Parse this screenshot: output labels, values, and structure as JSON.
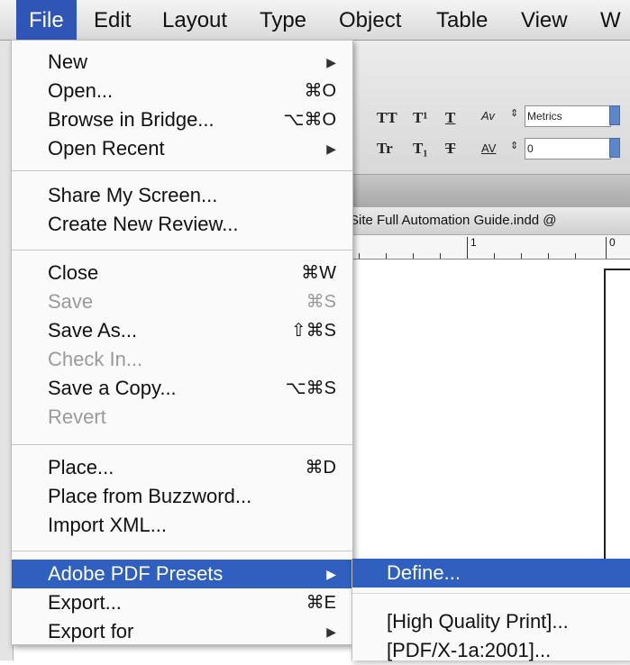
{
  "menubar": {
    "items": [
      {
        "label": "File"
      },
      {
        "label": "Edit"
      },
      {
        "label": "Layout"
      },
      {
        "label": "Type"
      },
      {
        "label": "Object"
      },
      {
        "label": "Table"
      },
      {
        "label": "View"
      },
      {
        "label": "W"
      }
    ],
    "active_color": "#2f56b7"
  },
  "toolbar": {
    "all_caps": "TT",
    "superscript": "T¹",
    "underline": "T",
    "small_caps": "Tr",
    "subscript": "T₁",
    "strikethrough": "T",
    "kerning_icon": "Av",
    "tracking_icon": "AV",
    "kerning_value": "Metrics",
    "tracking_value": "0"
  },
  "document": {
    "title": "Site Full Automation Guide.indd @",
    "ruler_numbers": [
      "1",
      "0"
    ]
  },
  "file_menu": {
    "sections": [
      [
        {
          "label": "New",
          "shortcut": "",
          "submenu": true,
          "enabled": true
        },
        {
          "label": "Open...",
          "shortcut": "⌘O",
          "submenu": false,
          "enabled": true
        },
        {
          "label": "Browse in Bridge...",
          "shortcut": "⌥⌘O",
          "submenu": false,
          "enabled": true
        },
        {
          "label": "Open Recent",
          "shortcut": "",
          "submenu": true,
          "enabled": true
        }
      ],
      [
        {
          "label": "Share My Screen...",
          "shortcut": "",
          "submenu": false,
          "enabled": true
        },
        {
          "label": "Create New Review...",
          "shortcut": "",
          "submenu": false,
          "enabled": true
        }
      ],
      [
        {
          "label": "Close",
          "shortcut": "⌘W",
          "submenu": false,
          "enabled": true
        },
        {
          "label": "Save",
          "shortcut": "⌘S",
          "submenu": false,
          "enabled": false
        },
        {
          "label": "Save As...",
          "shortcut": "⇧⌘S",
          "submenu": false,
          "enabled": true
        },
        {
          "label": "Check In...",
          "shortcut": "",
          "submenu": false,
          "enabled": false
        },
        {
          "label": "Save a Copy...",
          "shortcut": "⌥⌘S",
          "submenu": false,
          "enabled": true
        },
        {
          "label": "Revert",
          "shortcut": "",
          "submenu": false,
          "enabled": false
        }
      ],
      [
        {
          "label": "Place...",
          "shortcut": "⌘D",
          "submenu": false,
          "enabled": true
        },
        {
          "label": "Place from Buzzword...",
          "shortcut": "",
          "submenu": false,
          "enabled": true
        },
        {
          "label": "Import XML...",
          "shortcut": "",
          "submenu": false,
          "enabled": true
        }
      ],
      [
        {
          "label": "Adobe PDF Presets",
          "shortcut": "",
          "submenu": true,
          "enabled": true,
          "highlighted": true
        },
        {
          "label": "Export...",
          "shortcut": "⌘E",
          "submenu": false,
          "enabled": true
        },
        {
          "label": "Export for",
          "shortcut": "",
          "submenu": true,
          "enabled": true
        }
      ]
    ],
    "highlight_color": "#2f5fbf",
    "submenu_arrow": "▶"
  },
  "pdf_presets_submenu": {
    "items": [
      {
        "label": "Define...",
        "highlighted": true
      },
      {
        "label": "[High Quality Print]...",
        "highlighted": false
      },
      {
        "label": "[PDF/X-1a:2001]...",
        "highlighted": false
      }
    ]
  }
}
